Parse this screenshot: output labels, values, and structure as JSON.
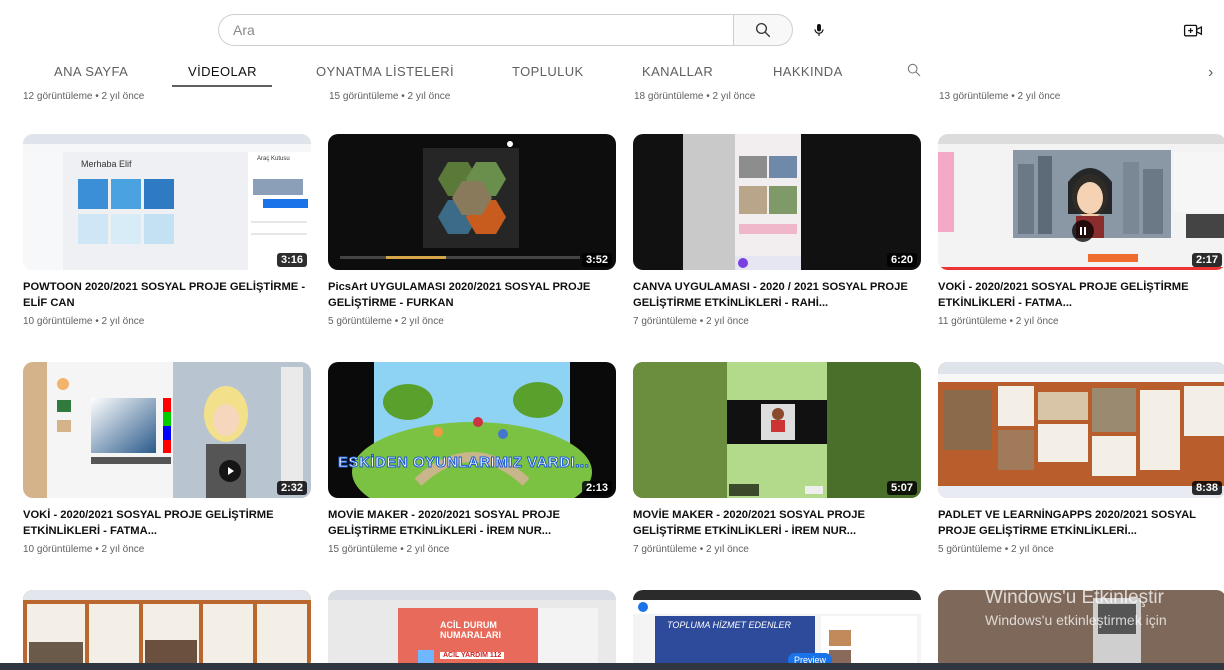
{
  "search": {
    "placeholder": "Ara"
  },
  "tabs": [
    {
      "label": "ANA SAYFA"
    },
    {
      "label": "VİDEOLAR"
    },
    {
      "label": "OYNATMA LİSTELERİ"
    },
    {
      "label": "TOPLULUK"
    },
    {
      "label": "KANALLAR"
    },
    {
      "label": "HAKKINDA"
    }
  ],
  "top_row_meta": [
    "12 görüntüleme • 2 yıl önce",
    "15 görüntüleme • 2 yıl önce",
    "18 görüntüleme • 2 yıl önce",
    "13 görüntüleme • 2 yıl önce"
  ],
  "videos": [
    {
      "title": "POWTOON 2020/2021 SOSYAL PROJE GELİŞTİRME - ELİF CAN",
      "meta": "10 görüntüleme • 2 yıl önce",
      "duration": "3:16",
      "thumb_text": "Merhaba Elif",
      "thumb_side": "Araç Kutusu"
    },
    {
      "title": "PicsArt UYGULAMASI 2020/2021 SOSYAL PROJE GELİŞTİRME - FURKAN",
      "meta": "5 görüntüleme • 2 yıl önce",
      "duration": "3:52"
    },
    {
      "title": "CANVA UYGULAMASI - 2020 / 2021 SOSYAL PROJE GELİŞTİRME ETKİNLİKLERİ - RAHİ...",
      "meta": "7 görüntüleme • 2 yıl önce",
      "duration": "6:20"
    },
    {
      "title": "VOKİ - 2020/2021 SOSYAL PROJE GELİŞTİRME ETKİNLİKLERİ - FATMA...",
      "meta": "11 görüntüleme • 2 yıl önce",
      "duration": "2:17"
    },
    {
      "title": "VOKİ - 2020/2021 SOSYAL PROJE GELİŞTİRME ETKİNLİKLERİ - FATMA...",
      "meta": "10 görüntüleme • 2 yıl önce",
      "duration": "2:32"
    },
    {
      "title": "MOVİE MAKER - 2020/2021 SOSYAL PROJE GELİŞTİRME ETKİNLİKLERİ - İREM NUR...",
      "meta": "15 görüntüleme • 2 yıl önce",
      "duration": "2:13",
      "thumb_text": "ESKİDEN OYUNLARIMIZ VARDI..."
    },
    {
      "title": "MOVİE MAKER - 2020/2021 SOSYAL PROJE GELİŞTİRME ETKİNLİKLERİ - İREM NUR...",
      "meta": "7 görüntüleme • 2 yıl önce",
      "duration": "5:07"
    },
    {
      "title": "PADLET VE LEARNİNGAPPS 2020/2021 SOSYAL PROJE GELİŞTİRME ETKİNLİKLERİ...",
      "meta": "5 görüntüleme • 2 yıl önce",
      "duration": "8:38"
    }
  ],
  "bottom_thumbs": [
    {},
    {
      "thumb_text": "ACİL DURUM NUMARALARI",
      "thumb_sub": "ACİL YARDIM 112"
    },
    {
      "thumb_text": "TOPLUMA HİZMET EDENLER",
      "thumb_badge": "Preview"
    },
    {}
  ],
  "watermark": {
    "line1": "Windows'u Etkinleştir",
    "line2": "Windows'u etkinleştirmek için"
  },
  "icons": {
    "search": "search-icon",
    "mic": "mic-icon",
    "create": "create-video-icon",
    "tab_search": "search-icon",
    "next": "chevron-right-icon"
  }
}
